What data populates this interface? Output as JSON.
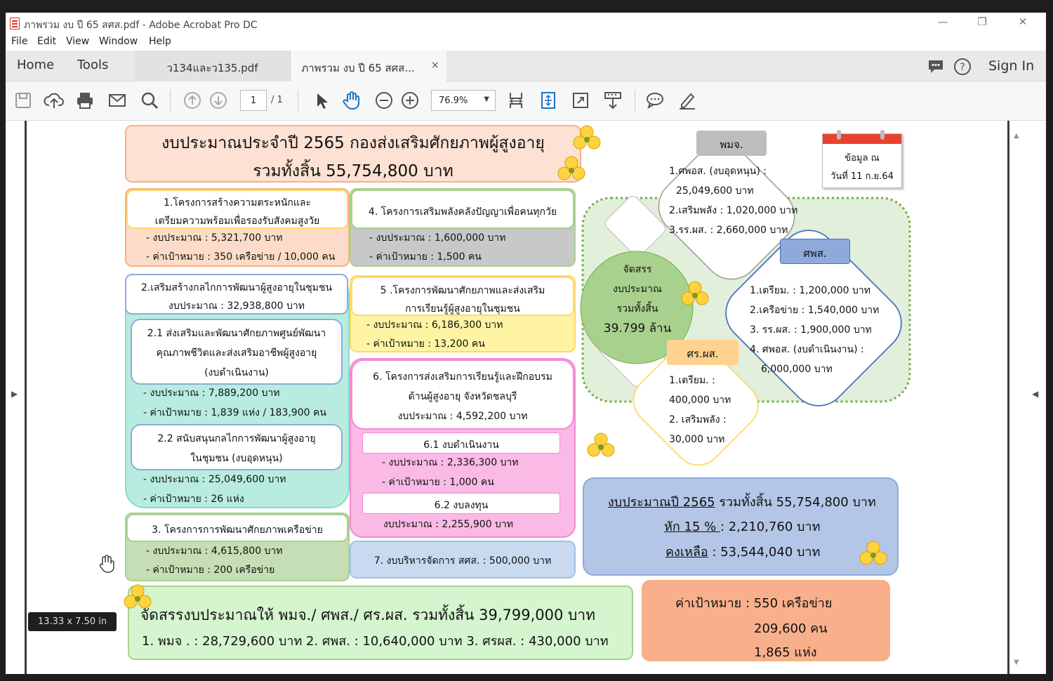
{
  "window": {
    "title": "ภาพรวม งบ ปี 65 สศส.pdf - Adobe Acrobat Pro DC"
  },
  "menu": [
    "File",
    "Edit",
    "View",
    "Window",
    "Help"
  ],
  "tabs": {
    "home": "Home",
    "tools": "Tools",
    "doc1": "ว134และว135.pdf",
    "doc2": "ภาพรวม งบ ปี 65 สศส...",
    "close": "×"
  },
  "header": {
    "sign_in": "Sign In"
  },
  "toolbar": {
    "page": "1",
    "page_total": "/ 1",
    "zoom": "76.9%"
  },
  "status": {
    "page_size": "13.33 x 7.50 in"
  },
  "doc": {
    "title1": "งบประมาณประจำปี 2565 กองส่งเสริมศักยภาพผู้สูงอายุ",
    "title2": "รวมทั้งสิ้น 55,754,800 บาท",
    "p1": {
      "h1": "1.โครงการสร้างความตระหนักและ",
      "h2": "เตรียมความพร้อมเพื่อรองรับสังคมสูงวัย",
      "l1": "- งบประมาณ  : 5,321,700 บาท",
      "l2": "- ค่าเป้าหมาย : 350 เครือข่าย / 10,000 คน"
    },
    "p2": {
      "h1": "2.เสริมสร้างกลไกการพัฒนาผู้สูงอายุในชุมชน",
      "h2": "งบประมาณ : 32,938,800 บาท"
    },
    "p21": {
      "h1": "2.1 ส่งเสริมและพัฒนาศักยภาพศูนย์พัฒนา",
      "h2": "คุณภาพชีวิตและส่งเสริมอาชีพผู้สูงอายุ",
      "h3": "(งบดำเนินงาน)",
      "l1": "- งบประมาณ : 7,889,200    บาท",
      "l2": "- ค่าเป้าหมาย :    1,839 แห่ง / 183,900 คน"
    },
    "p22": {
      "h1": "2.2 สนับสนุนกลไกการพัฒนาผู้สูงอายุ",
      "h2": "ในชุมชน  (งบอุดหนุน)",
      "l1": "- งบประมาณ : 25,049,600 บาท",
      "l2": "- ค่าเป้าหมาย :    26 แห่ง"
    },
    "p3": {
      "h1": "3. โครงการการพัฒนาศักยภาพเครือข่าย",
      "l1": "- งบประมาณ :    4,615,800 บาท",
      "l2": "- ค่าเป้าหมาย :   200 เครือข่าย"
    },
    "p4": {
      "h1": "4. โครงการเสริมพลังคลังปัญญาเพื่อคนทุกวัย",
      "l1": "- งบประมาณ :    1,600,000 บาท",
      "l2": "- ค่าเป้าหมาย :    1,500 คน"
    },
    "p5": {
      "h1": "5 .โครงการพัฒนาศักยภาพและส่งเสริม",
      "h2": "การเรียนรู้ผู้สูงอายุในชุมชน",
      "l1": "- งบประมาณ :    6,186,300 บาท",
      "l2": "- ค่าเป้าหมาย :    13,200 คน"
    },
    "p6": {
      "h1": "6. โครงการส่งเสริมการเรียนรู้และฝึกอบรม",
      "h2": "ด้านผู้สูงอายุ จังหวัดชลบุรี",
      "h3": "งบประมาณ : 4,592,200 บาท"
    },
    "p61": {
      "h1": "6.1 งบดำเนินงาน",
      "l1": "- งบประมาณ : 2,336,300 บาท",
      "l2": "- ค่าเป้าหมาย : 1,000 คน"
    },
    "p62": {
      "h1": "6.2 งบลงทุน",
      "l1": "งบประมาณ : 2,255,900 บาท"
    },
    "p7": {
      "h1": "7. งบบริหารจัดการ สศส. : 500,000 บาท"
    },
    "alloc": {
      "l1": "จัดสรรงบประมาณให้ พมจ./ ศพส./ ศร.ผส. รวมทั้งสิ้น 39,799,000 บาท",
      "l2": "1. พมจ . : 28,729,600 บาท  2. ศพส. : 10,640,000 บาท  3. ศรผส. : 430,000 บาท"
    },
    "center": {
      "l1": "จัดสรร",
      "l2": "งบประมาณ",
      "l3": "รวมทั้งสิ้น",
      "l4": "39.799 ล้าน"
    },
    "pmj": {
      "label": "พมจ.",
      "l1": "1.ศพอส. (งบอุดหนุน) :",
      "l2": "25,049,600 บาท",
      "l3": "2.เสริมพลัง : 1,020,000 บาท",
      "l4": "3.รร.ผส. : 2,660,000 บาท"
    },
    "spos": {
      "label": "ศพส.",
      "l1": "1.เตรียม. : 1,200,000 บาท",
      "l2": "2.เครือข่าย : 1,540,000 บาท",
      "l3": "3. รร.ผส. : 1,900,000 บาท",
      "l4": "4. ศพอส. (งบดำเนินงาน) :",
      "l5": "6,000,000 บาท"
    },
    "srps": {
      "label": "ศร.ผส.",
      "l1": "1.เตรียม. :",
      "l2": "400,000 บาท",
      "l3": "2. เสริมพลัง :",
      "l4": "30,000 บาท"
    },
    "calendar": {
      "l1": "ข้อมูล ณ",
      "l2": "วันที่ 11 ก.ย.64"
    },
    "summary": {
      "l1a": "งบประมาณปี 2565",
      "l1b": " รวมทั้งสิ้น 55,754,800 บาท",
      "l2a": "หัก 15 % ",
      "l2b": ": 2,210,760 บาท",
      "l3a": "คงเหลือ",
      "l3b": " : 53,544,040 บาท"
    },
    "target": {
      "l1": "ค่าเป้าหมาย :  550 เครือข่าย",
      "l2": "209,600 คน",
      "l3": "1,865 แห่ง"
    }
  }
}
